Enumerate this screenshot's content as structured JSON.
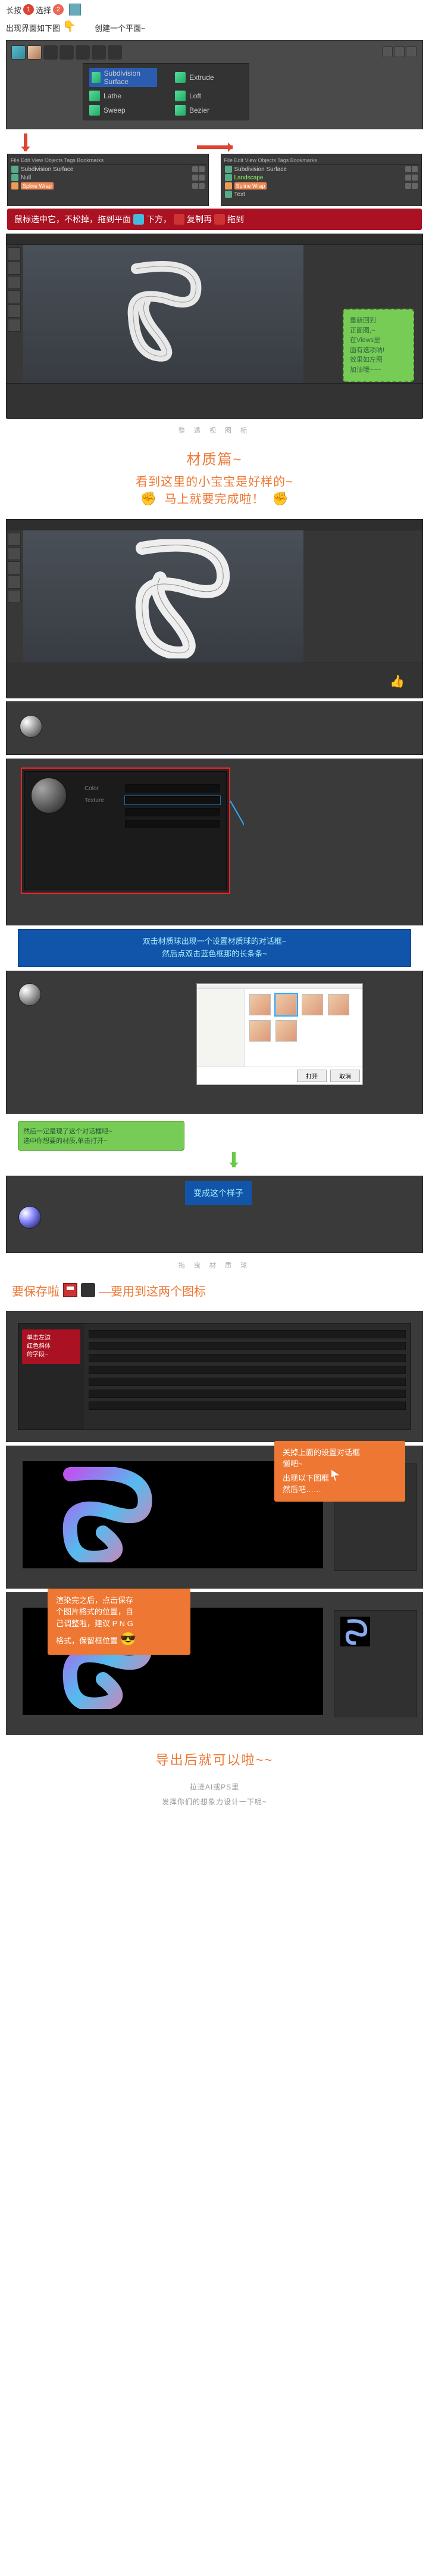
{
  "intro": {
    "text_a": "长按",
    "num1": "1",
    "text_b": "选择",
    "num2": "2",
    "cube_name": "cube-tool",
    "line2_a": "出现界面如下图",
    "line2_b": "创建一个平面~"
  },
  "generator_menu": {
    "items_left": [
      "Subdivision Surface",
      "Lathe",
      "Sweep"
    ],
    "items_right": [
      "Extrude",
      "Loft",
      "Bezier"
    ]
  },
  "obj_mgr_left": {
    "tabs": "File  Edit  View  Objects  Tags  Bookmarks",
    "items": [
      {
        "label": "Subdivision Surface",
        "cls": ""
      },
      {
        "label": "Null",
        "cls": ""
      },
      {
        "label": "Spline Wrap",
        "cls": "orange",
        "hl": true
      }
    ]
  },
  "obj_mgr_right": {
    "tabs": "File  Edit  View  Objects  Tags  Bookmarks",
    "label_top": "Subdivision Surface",
    "items": [
      {
        "label": "Landscape",
        "cls": "green"
      },
      {
        "label": "Spline Wrap",
        "cls": "orange",
        "hl": true
      },
      {
        "label": "Text",
        "cls": ""
      }
    ]
  },
  "red_bar": {
    "text_a": "鼠标选中它，不松掉，拖到平面",
    "text_b": "下方，",
    "text_c": "复制再",
    "text_d": "拖到"
  },
  "green_note_1": {
    "l1": "重新回到",
    "l2": "正面图,~",
    "l3": "在Views里",
    "l4": "面有选项呐!",
    "l5": "效果如左图",
    "l6": "加油哦~~~"
  },
  "caption_1": "整 透 视 图 标",
  "orange_heading_1": {
    "title": "材质篇~",
    "sub_a": "看到这里的小宝宝是好样的~",
    "sub_b": "马上就要完成啦！"
  },
  "blue_callout_1": {
    "l1": "双击材质球出现一个设置材质球的对话框~",
    "l2": "然后点双击蓝色框那的长条条~"
  },
  "green_mini_1": {
    "l1": "然后一定是现了这个对话框吧~",
    "l2": "选中你想要的材质,单击打开~"
  },
  "blue_mini_1": "变成这个样子",
  "caption_2": "拖 曳 材 质 球",
  "save_heading": {
    "text_a": "要保存啦",
    "text_b": "—要用到这两个图标"
  },
  "red_box_render": {
    "l1": "单击左边",
    "l2": "红色斜体",
    "l3": "的字段~"
  },
  "orange_callout_1": {
    "l1": "关掉上面的设置对话框",
    "l2": "懒吧~",
    "l3": "出现以下图框",
    "l4": "然后吧……"
  },
  "orange_callout_2": {
    "l1": "渲染完之后，点击保存",
    "l2": "个图片格式的位置，自",
    "l3": "己调整啦，建议 P N G",
    "l4": "格式，保留框位置"
  },
  "final_heading": "导出后就可以啦~~",
  "footer": {
    "l1": "拉进AI或PS里",
    "l2": "发挥你们的想象力设计一下呢~"
  },
  "filebrowser": {
    "open_btn": "打开",
    "cancel_btn": "取消"
  }
}
